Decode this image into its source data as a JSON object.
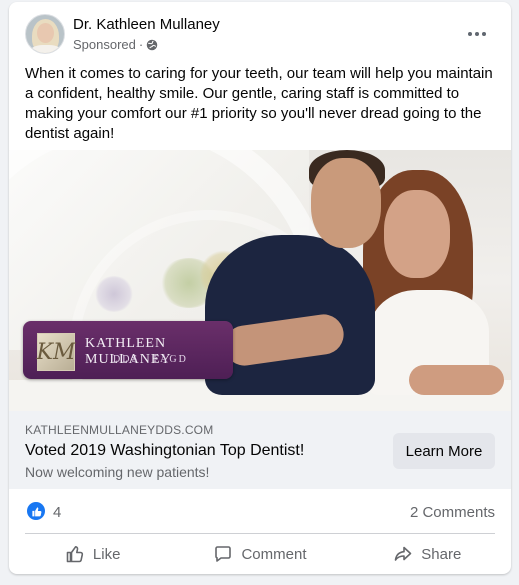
{
  "post": {
    "author": "Dr. Kathleen Mullaney",
    "sponsored_label": "Sponsored",
    "separator": "·",
    "body": "When it comes to caring for your teeth, our team will help you maintain a confident, healthy smile. Our gentle, caring staff is committed to making your comfort our #1 priority so you'll never dread going to the dentist again!"
  },
  "ad_image": {
    "logo_name": "KATHLEEN MULLANEY",
    "logo_credentials": "DDS · FAGD",
    "logo_monogram": "KM"
  },
  "link": {
    "domain": "KATHLEENMULLANEYDDS.COM",
    "title": "Voted 2019 Washingtonian Top Dentist!",
    "description": "Now welcoming new patients!",
    "cta_label": "Learn More"
  },
  "stats": {
    "like_count": "4",
    "comments": "2 Comments"
  },
  "actions": {
    "like": "Like",
    "comment": "Comment",
    "share": "Share"
  },
  "colors": {
    "facebook_blue": "#1877f2",
    "secondary_text": "#65676b",
    "logo_purple": "#5a2660"
  },
  "icons": {
    "globe": "globe-icon",
    "more": "more-options-icon",
    "like_reaction": "thumbs-up-reaction-icon",
    "like": "thumbs-up-icon",
    "comment": "comment-bubble-icon",
    "share": "share-arrow-icon"
  }
}
